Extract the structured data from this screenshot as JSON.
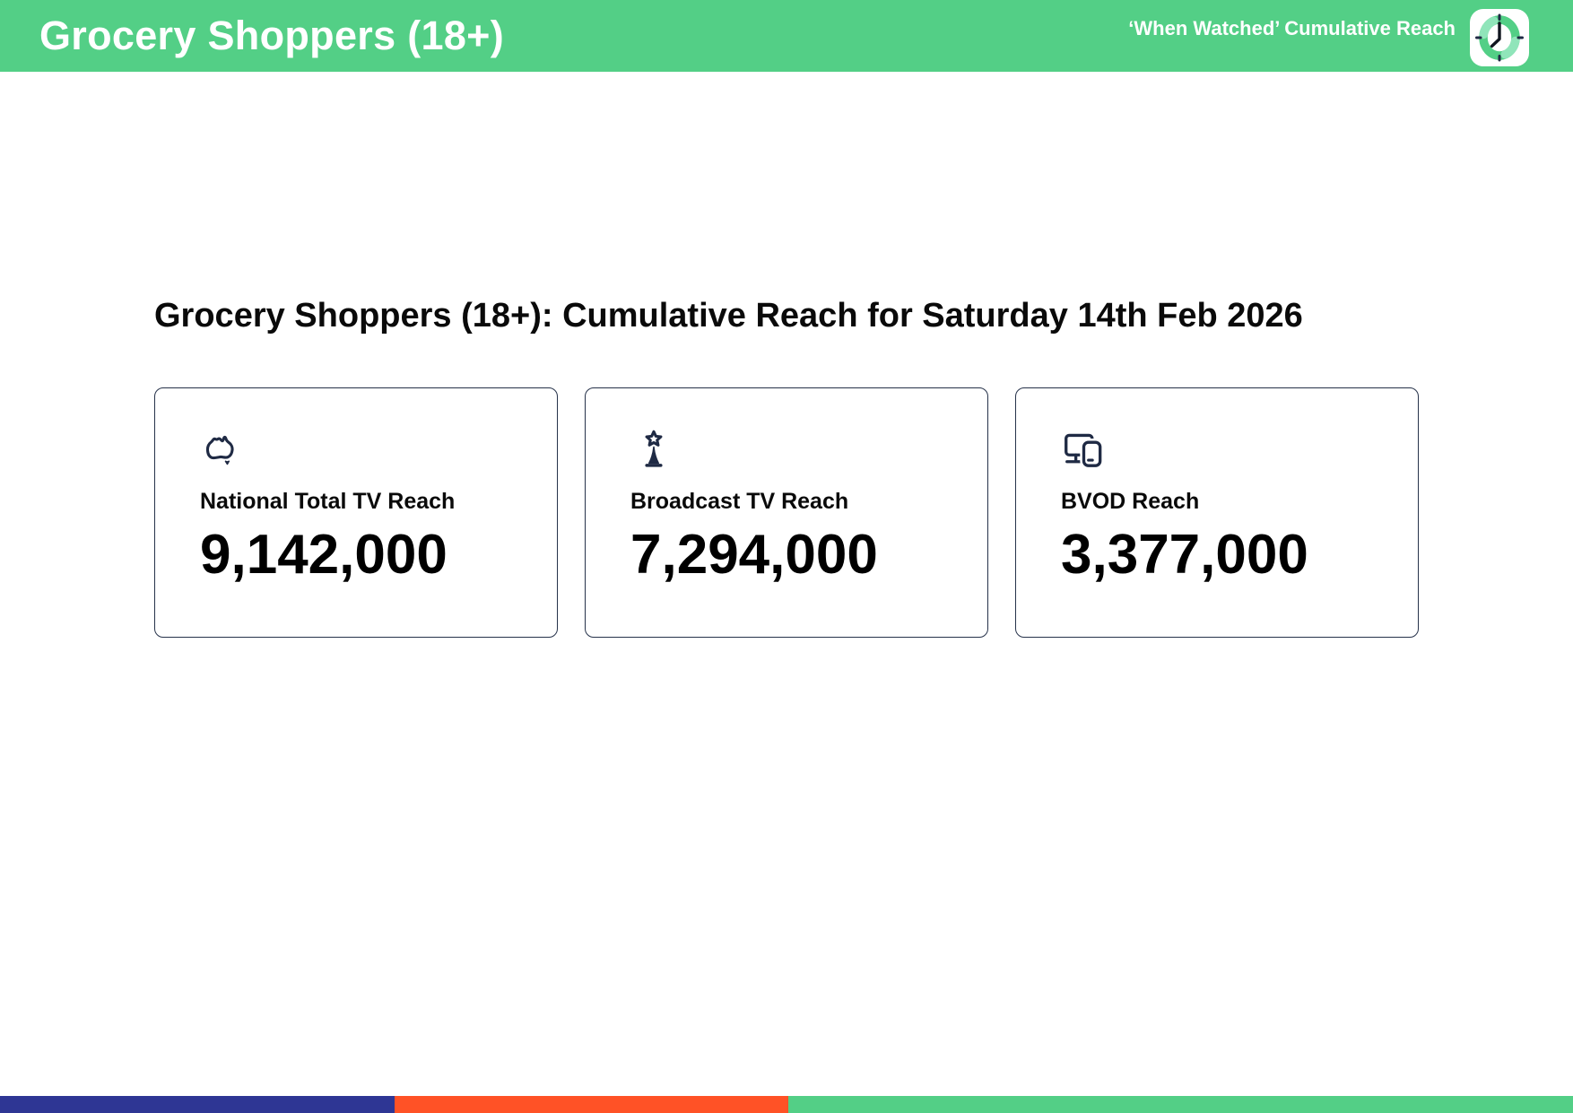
{
  "header": {
    "title": "Grocery Shoppers (18+)",
    "subtitle": "‘When Watched’ Cumulative Reach",
    "clock_icon": "clock-icon"
  },
  "main": {
    "heading": "Grocery Shoppers (18+): Cumulative Reach for Saturday 14th Feb 2026",
    "cards": [
      {
        "icon": "australia-map-icon",
        "label": "National Total TV Reach",
        "value": "9,142,000"
      },
      {
        "icon": "broadcast-tower-icon",
        "label": "Broadcast TV Reach",
        "value": "7,294,000"
      },
      {
        "icon": "tv-and-phone-icon",
        "label": "BVOD Reach",
        "value": "3,377,000"
      }
    ]
  },
  "footer": {
    "segments": [
      {
        "name": "blue-segment",
        "color": "#2E3694",
        "width_pct": 25
      },
      {
        "name": "orange-segment",
        "color": "#FF5226",
        "width_pct": 25
      },
      {
        "name": "green-segment",
        "color": "#53CF86",
        "width_pct": 50
      }
    ]
  },
  "colors": {
    "brand_green": "#53CF86",
    "icon_navy": "#1F2A44",
    "card_border": "#26324A",
    "footer_blue": "#2E3694",
    "footer_orange": "#FF5226",
    "text_black": "#0A0A0A"
  }
}
